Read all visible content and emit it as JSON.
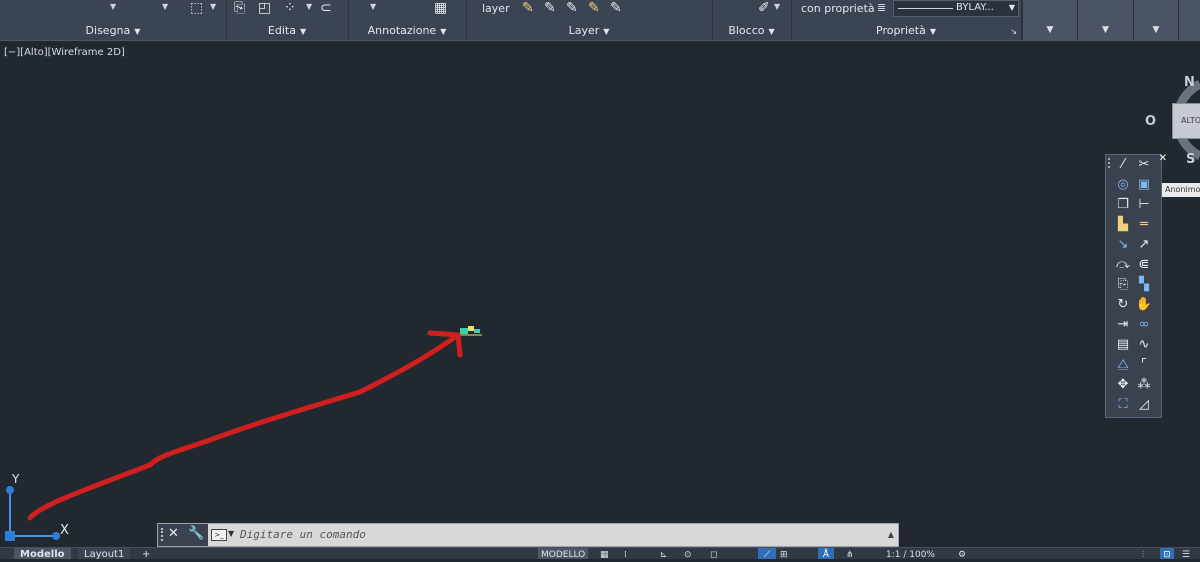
{
  "ribbon": {
    "panels": [
      {
        "title": "Disegna"
      },
      {
        "title": "Edita"
      },
      {
        "title": "Annotazione"
      },
      {
        "title": "Layer"
      },
      {
        "title": "Blocco"
      },
      {
        "title": "Proprietà"
      }
    ],
    "layer_label": "layer",
    "properties_label": "con proprietà",
    "linetype_value": "BYLAY..."
  },
  "viewport": {
    "label": "[−][Alto][Wireframe 2D]"
  },
  "viewcube": {
    "north": "N",
    "west": "O",
    "south": "S",
    "face": "ALTO"
  },
  "tooltip": "Anonimo",
  "ucs": {
    "x_label": "X",
    "y_label": "Y"
  },
  "command": {
    "placeholder": "Digitare un comando"
  },
  "status": {
    "tab_model": "Modello",
    "tab_layout": "Layout1",
    "tab_add": "+",
    "model_label": "MODELLO",
    "scale": "1:1 / 100%"
  },
  "colors": {
    "canvas": "#212830",
    "ribbon": "#3b4453",
    "annotation_arrow": "#d01f1f",
    "ucs_blue": "#2d7fd6"
  }
}
